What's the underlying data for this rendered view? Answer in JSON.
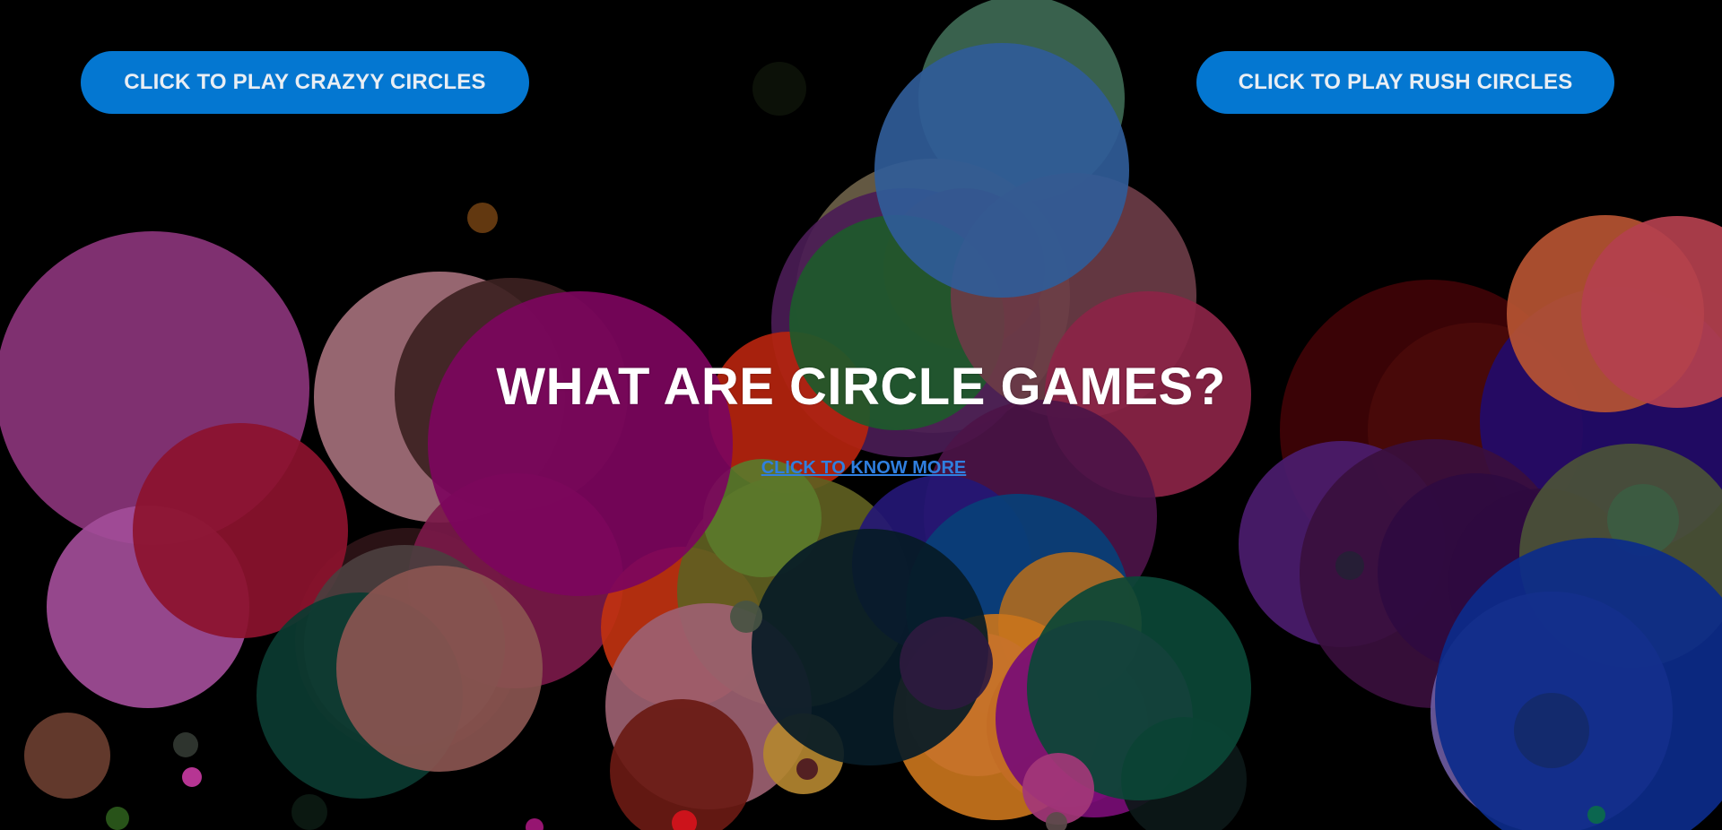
{
  "buttons": {
    "left_label": "CLICK TO PLAY CRAZYY CIRCLES",
    "right_label": "CLICK TO PLAY RUSH CIRCLES"
  },
  "headline": "WHAT ARE CIRCLE GAMES?",
  "know_more_link": "CLICK TO KNOW MORE",
  "colors": {
    "background": "#000000",
    "button_bg": "#0477d1",
    "button_text": "#e9eef4",
    "headline_text": "#ffffff",
    "link_text": "#2f7fe0"
  }
}
